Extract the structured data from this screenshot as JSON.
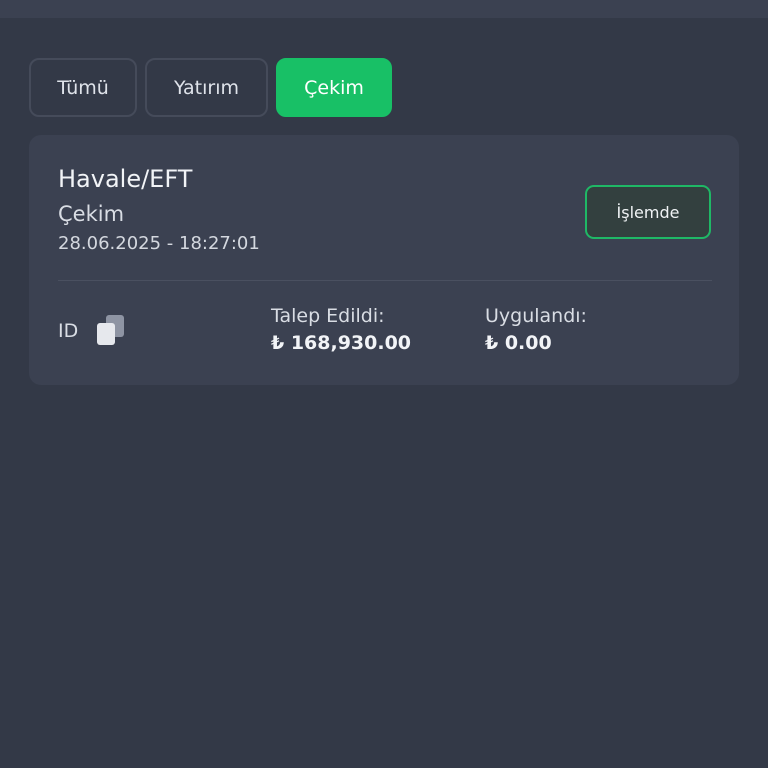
{
  "tabs": [
    {
      "label": "Tümü",
      "active": false
    },
    {
      "label": "Yatırım",
      "active": false
    },
    {
      "label": "Çekim",
      "active": true
    }
  ],
  "transaction": {
    "method": "Havale/EFT",
    "type": "Çekim",
    "datetime": "28.06.2025 - 18:27:01",
    "status": "İşlemde",
    "id_label": "ID",
    "requested_label": "Talep Edildi:",
    "requested_amount": "₺ 168,930.00",
    "applied_label": "Uygulandı:",
    "applied_amount": "₺ 0.00"
  },
  "icons": {
    "copy": "copy-icon"
  },
  "colors": {
    "accent": "#18c066",
    "background": "#333947",
    "card": "#3b4151"
  }
}
